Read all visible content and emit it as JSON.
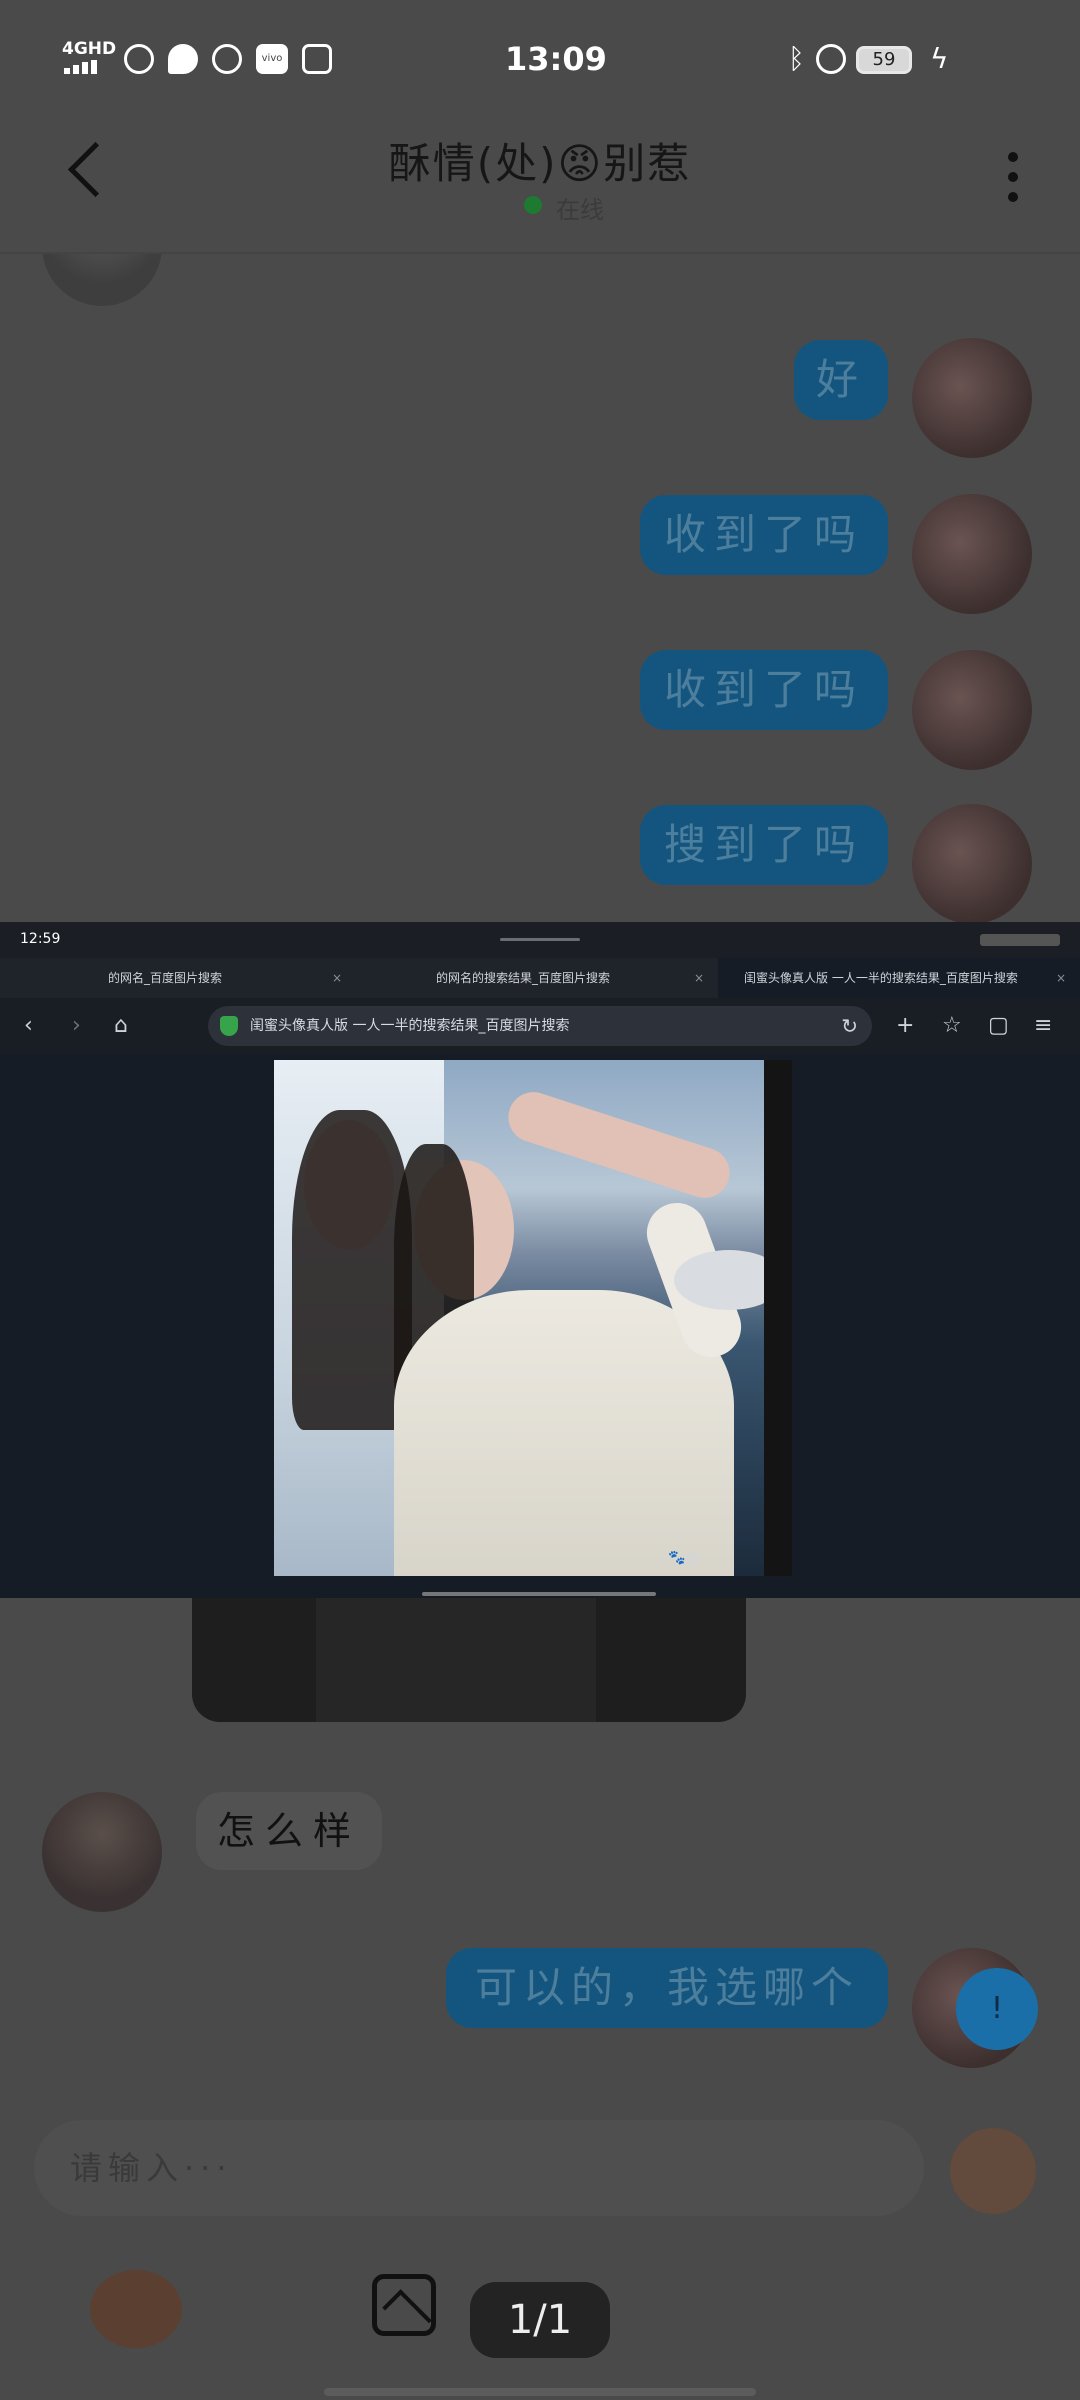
{
  "status_bar": {
    "time": "13:09",
    "network": "4GHD",
    "battery": "59",
    "app_icons": [
      "no-signal-icon",
      "message-icon",
      "browser-icon",
      "vivo-icon",
      "play-icon"
    ],
    "right_icons": [
      "bluetooth-icon",
      "alarm-icon",
      "battery-icon",
      "charging-icon"
    ]
  },
  "header": {
    "title": "酥情(处)😡别惹",
    "status": "在线"
  },
  "messages": [
    {
      "side": "right",
      "text": "好"
    },
    {
      "side": "right",
      "text": "收到了吗"
    },
    {
      "side": "right",
      "text": "收到了吗"
    },
    {
      "side": "right",
      "text": "搜到了吗"
    },
    {
      "side": "left",
      "text": "怎么样"
    },
    {
      "side": "right",
      "text": "可以的，我选哪个"
    }
  ],
  "overlay_browser": {
    "time": "12:59",
    "tabs": [
      {
        "label": "的网名_百度图片搜索"
      },
      {
        "label": "的网名的搜索结果_百度图片搜索"
      },
      {
        "label": "闺蜜头像真人版 一人一半的搜索结果_百度图片搜索"
      }
    ],
    "url_text": "闺蜜头像真人版 一人一半的搜索结果_百度图片搜索",
    "image_watermark": "🐾@"
  },
  "input": {
    "placeholder": "请输入···"
  },
  "float_button": "!",
  "counter": "1/1",
  "colors": {
    "accent_blue": "#14557f",
    "bg": "#4a4a4a",
    "overlay_bg": "#151c26"
  }
}
